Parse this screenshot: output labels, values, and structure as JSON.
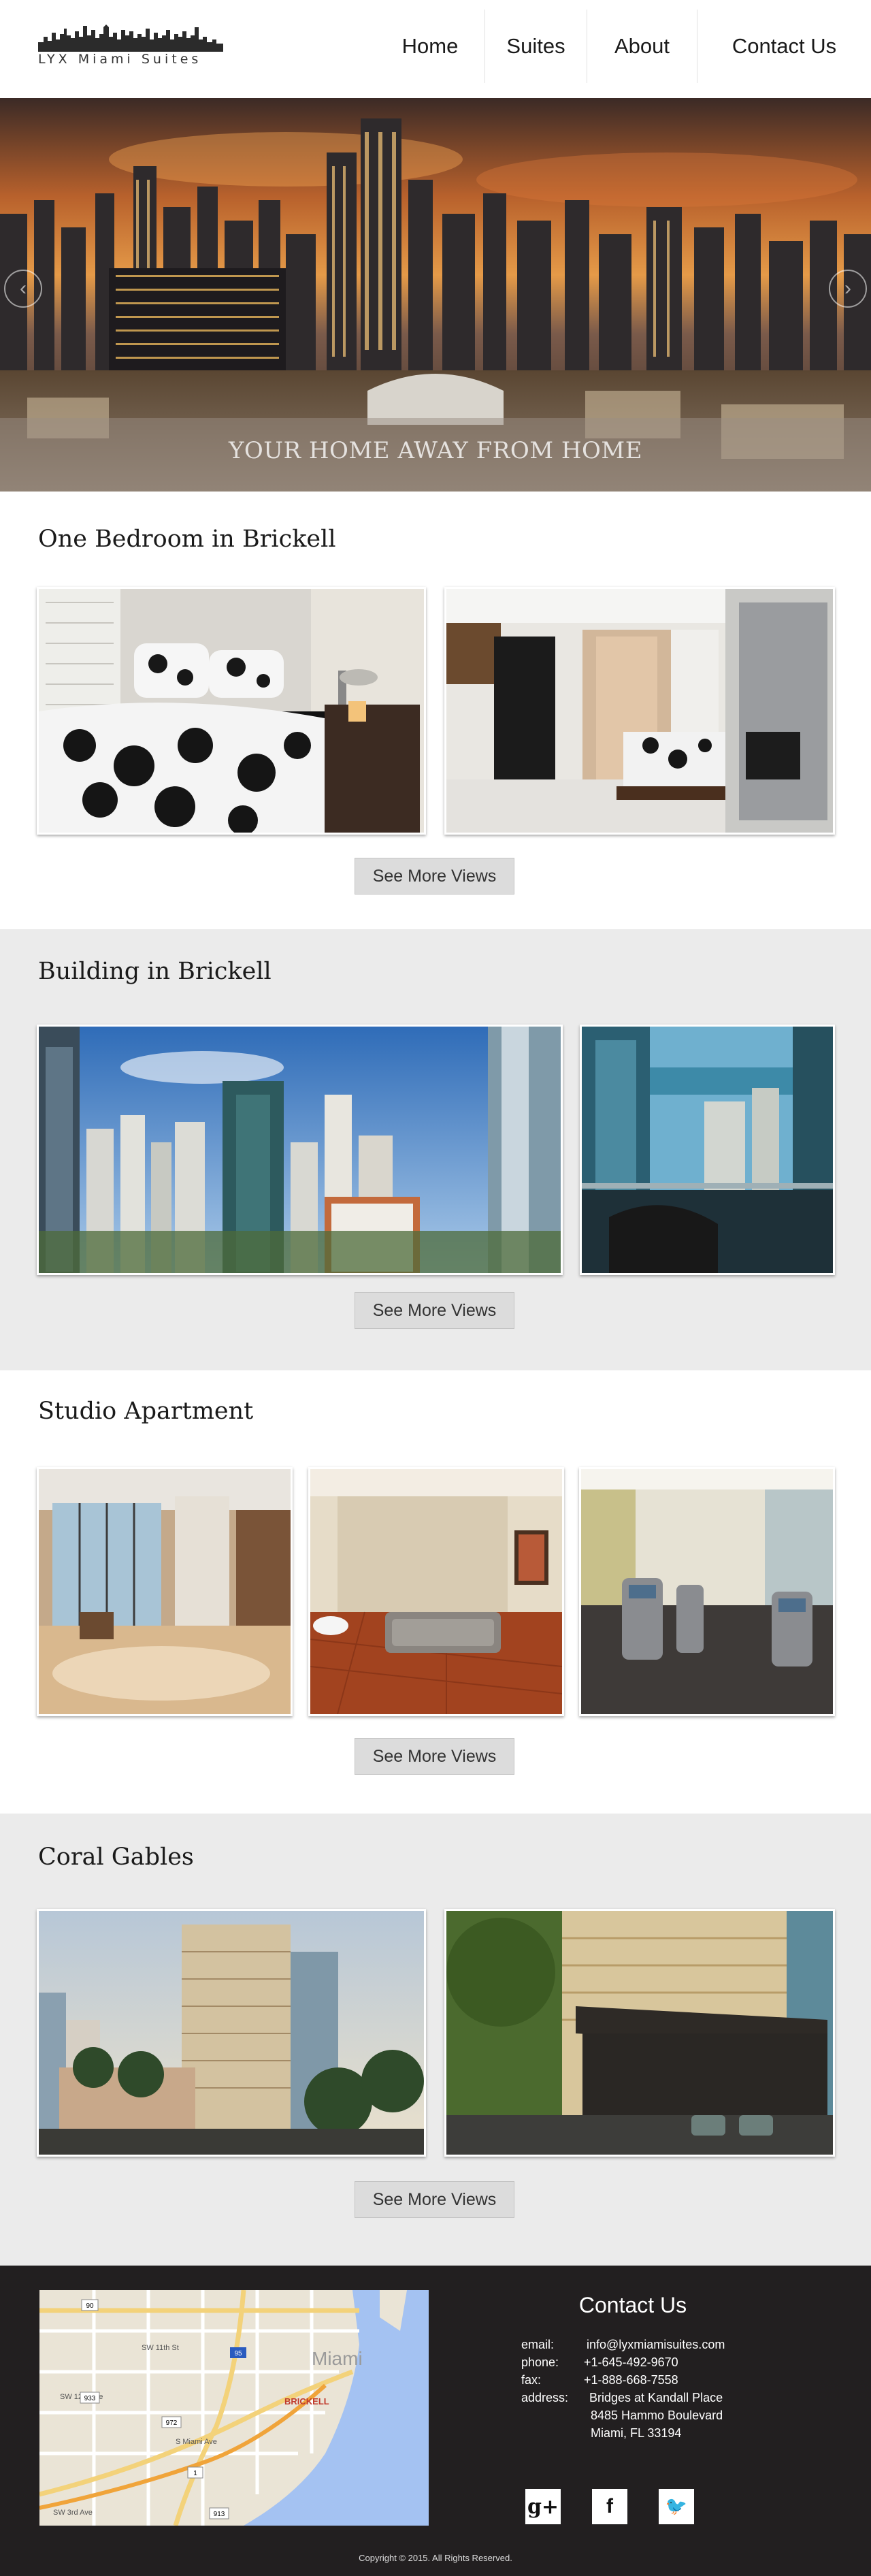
{
  "header": {
    "logo_text": "LYX Miami Suites",
    "nav": [
      {
        "label": "Home"
      },
      {
        "label": "Suites"
      },
      {
        "label": "About"
      },
      {
        "label": "Contact Us"
      }
    ]
  },
  "hero": {
    "caption": "YOUR HOME AWAY FROM HOME",
    "prev_icon": "chevron-left-icon",
    "next_icon": "chevron-right-icon"
  },
  "sections": [
    {
      "title": "One Bedroom in Brickell",
      "button": "See More Views"
    },
    {
      "title": "Building in Brickell",
      "button": "See More Views"
    },
    {
      "title": "Studio Apartment",
      "button": "See More Views"
    },
    {
      "title": "Coral Gables",
      "button": "See More Views"
    }
  ],
  "footer": {
    "contact_title": "Contact Us",
    "email_label": "email:",
    "email": "info@lyxmiamisuites.com",
    "phone_label": "phone:",
    "phone": "+1-645-492-9670",
    "fax_label": "fax:",
    "fax": "+1-888-668-7558",
    "address_label": "address:",
    "address_line1": "Bridges at Kandall Place",
    "address_line2": "8485 Hammo Boulevard",
    "address_line3": "Miami, FL 33194",
    "social": [
      {
        "icon": "google-plus-icon",
        "glyph": "g+"
      },
      {
        "icon": "facebook-icon",
        "glyph": "f"
      },
      {
        "icon": "twitter-icon",
        "glyph": "🐦"
      }
    ],
    "copyright": "Copyright © 2015. All Rights Reserved."
  },
  "map": {
    "labels": {
      "city": "Miami",
      "district": "BRICKELL",
      "street1": "SW 11th St",
      "street2": "SW 3rd Ave",
      "street3": "S Miami Ave",
      "street4": "SW 12th Ave",
      "shield1": "90",
      "shield2": "95",
      "shield3": "972",
      "shield4": "913",
      "shield5": "933",
      "shield6": "1"
    }
  },
  "colors": {
    "footer_bg": "#221f20",
    "gray_section": "#ebebeb",
    "button_bg": "#dcdcdc"
  }
}
